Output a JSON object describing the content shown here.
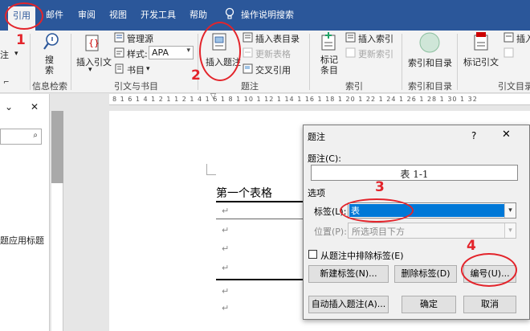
{
  "tabs": [
    {
      "id": "references",
      "label": "引用",
      "active": true
    },
    {
      "id": "mailings",
      "label": "邮件"
    },
    {
      "id": "review",
      "label": "审阅"
    },
    {
      "id": "view",
      "label": "视图"
    },
    {
      "id": "developer",
      "label": "开发工具"
    },
    {
      "id": "help",
      "label": "帮助"
    },
    {
      "id": "tell-me",
      "label": "操作说明搜索"
    }
  ],
  "ribbon": {
    "left_partial": "注",
    "search_btn": "搜\n索",
    "insert_citation": "插入引文",
    "manage_sources": "管理源",
    "style_label": "样式:",
    "style_value": "APA",
    "bibliography": "书目",
    "insert_caption": "插入题注",
    "insert_table_of_figures": "插入表目录",
    "update_table": "更新表格",
    "cross_reference": "交叉引用",
    "mark_entry": "标记\n条目",
    "insert_index": "插入索引",
    "update_index": "更新索引",
    "table_of_authorities": "索引和目录",
    "mark_citation": "标记引文",
    "insert_right_partial": "插入",
    "groups": {
      "insights": "信息检索",
      "citations": "引文与书目",
      "captions": "题注",
      "index": "索引",
      "authorities": "索引和目录",
      "authorities2": "引文目录"
    }
  },
  "leftpane": {
    "headings_label": "题应用标题"
  },
  "ruler_text": "8 1 6 1 4 1 2 1    1 2 1 4 1 6 1 8 1 10 1 12 1 14 1 16 1 18 1 20 1 22 1 24 1 26 1 28 1 30 1 32",
  "document": {
    "caption_text": "第一个表格",
    "para_mark": "↵"
  },
  "dialog": {
    "title": "题注",
    "help": "?",
    "close": "✕",
    "caption_label": "题注(C):",
    "caption_value": "表 1-1",
    "options_label": "选项",
    "label_label": "标签(L):",
    "label_value": "表",
    "position_label": "位置(P):",
    "position_value": "所选项目下方",
    "exclude_label": "从题注中排除标签(E)",
    "new_label_btn": "新建标签(N)...",
    "delete_label_btn": "删除标签(D)",
    "numbering_btn": "编号(U)...",
    "autocaption_btn": "自动插入题注(A)...",
    "ok_btn": "确定",
    "cancel_btn": "取消"
  },
  "annotations": {
    "step1": "1",
    "step2": "2",
    "step3": "3",
    "step4": "4"
  },
  "colors": {
    "ribbon_blue": "#2b579a",
    "annotation_red": "#e3242b",
    "selection_blue": "#0078d7"
  }
}
